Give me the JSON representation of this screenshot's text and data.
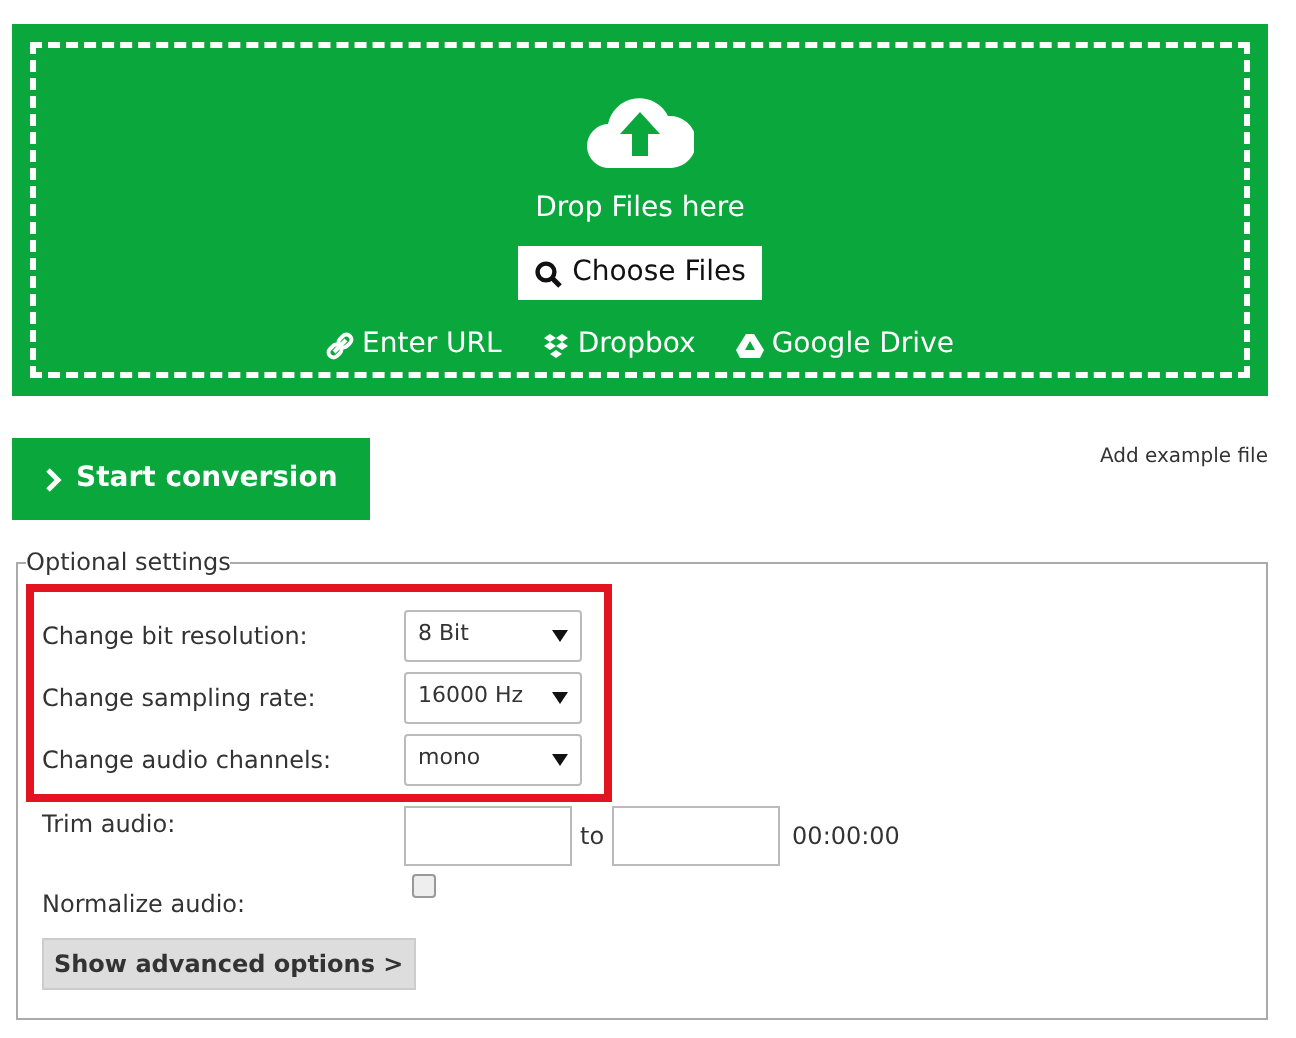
{
  "upload": {
    "drop_text": "Drop Files here",
    "choose_button": "Choose Files",
    "sources": [
      {
        "kind": "url",
        "label": "Enter URL"
      },
      {
        "kind": "dropbox",
        "label": "Dropbox"
      },
      {
        "kind": "drive",
        "label": "Google Drive"
      }
    ]
  },
  "start_button": "Start conversion",
  "example_link": "Add example file",
  "optional_settings": {
    "legend": "Optional settings",
    "highlighted": [
      {
        "label": "Change bit resolution:",
        "value": "8 Bit"
      },
      {
        "label": "Change sampling rate:",
        "value": "16000 Hz"
      },
      {
        "label": "Change audio channels:",
        "value": "mono"
      }
    ],
    "trim": {
      "label": "Trim audio:",
      "separator": "to",
      "hint": "00:00:00"
    },
    "normalize": {
      "label": "Normalize audio:",
      "checked": false
    },
    "advanced_button": "Show advanced options >"
  }
}
